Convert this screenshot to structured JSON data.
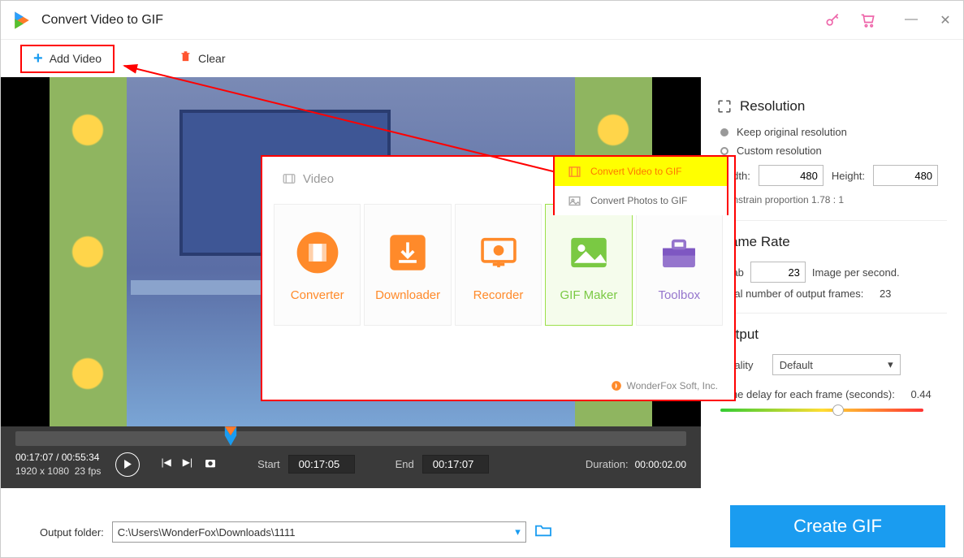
{
  "window": {
    "title": "Convert Video to GIF"
  },
  "toolbar": {
    "add_video": "Add Video",
    "clear": "Clear"
  },
  "submenu": {
    "video_to_gif": "Convert Video to GIF",
    "photos_to_gif": "Convert Photos to GIF"
  },
  "popup": {
    "tab_label": "Video",
    "cards": {
      "converter": "Converter",
      "downloader": "Downloader",
      "recorder": "Recorder",
      "gifmaker": "GIF Maker",
      "toolbox": "Toolbox"
    },
    "footer": "WonderFox Soft, Inc."
  },
  "player": {
    "current_time": "00:17:07",
    "total_time": "00:55:34",
    "dimensions": "1920 x 1080",
    "fps": "23 fps",
    "start_label": "Start",
    "start_value": "00:17:05",
    "end_label": "End",
    "end_value": "00:17:07",
    "duration_label": "Duration:",
    "duration_value": "00:00:02.00"
  },
  "resolution": {
    "title": "Resolution",
    "keep": "Keep original resolution",
    "custom": "Custom resolution",
    "width_label": "Width:",
    "width_value": "480",
    "height_label": "Height:",
    "height_value": "480",
    "constrain": "Constrain proportion  1.78 : 1"
  },
  "framerate": {
    "title": "Frame Rate",
    "grab_label": "Grab",
    "grab_value": "23",
    "per_second": "Image per second.",
    "total_label": "Total number of output frames:",
    "total_value": "23"
  },
  "output": {
    "title": "Output",
    "quality_label": "Quality",
    "quality_value": "Default",
    "delay_label": "Time delay for each frame (seconds):",
    "delay_value": "0.44"
  },
  "output_folder": {
    "label": "Output folder:",
    "path": "C:\\Users\\WonderFox\\Downloads\\1111"
  },
  "create_button": "Create GIF"
}
